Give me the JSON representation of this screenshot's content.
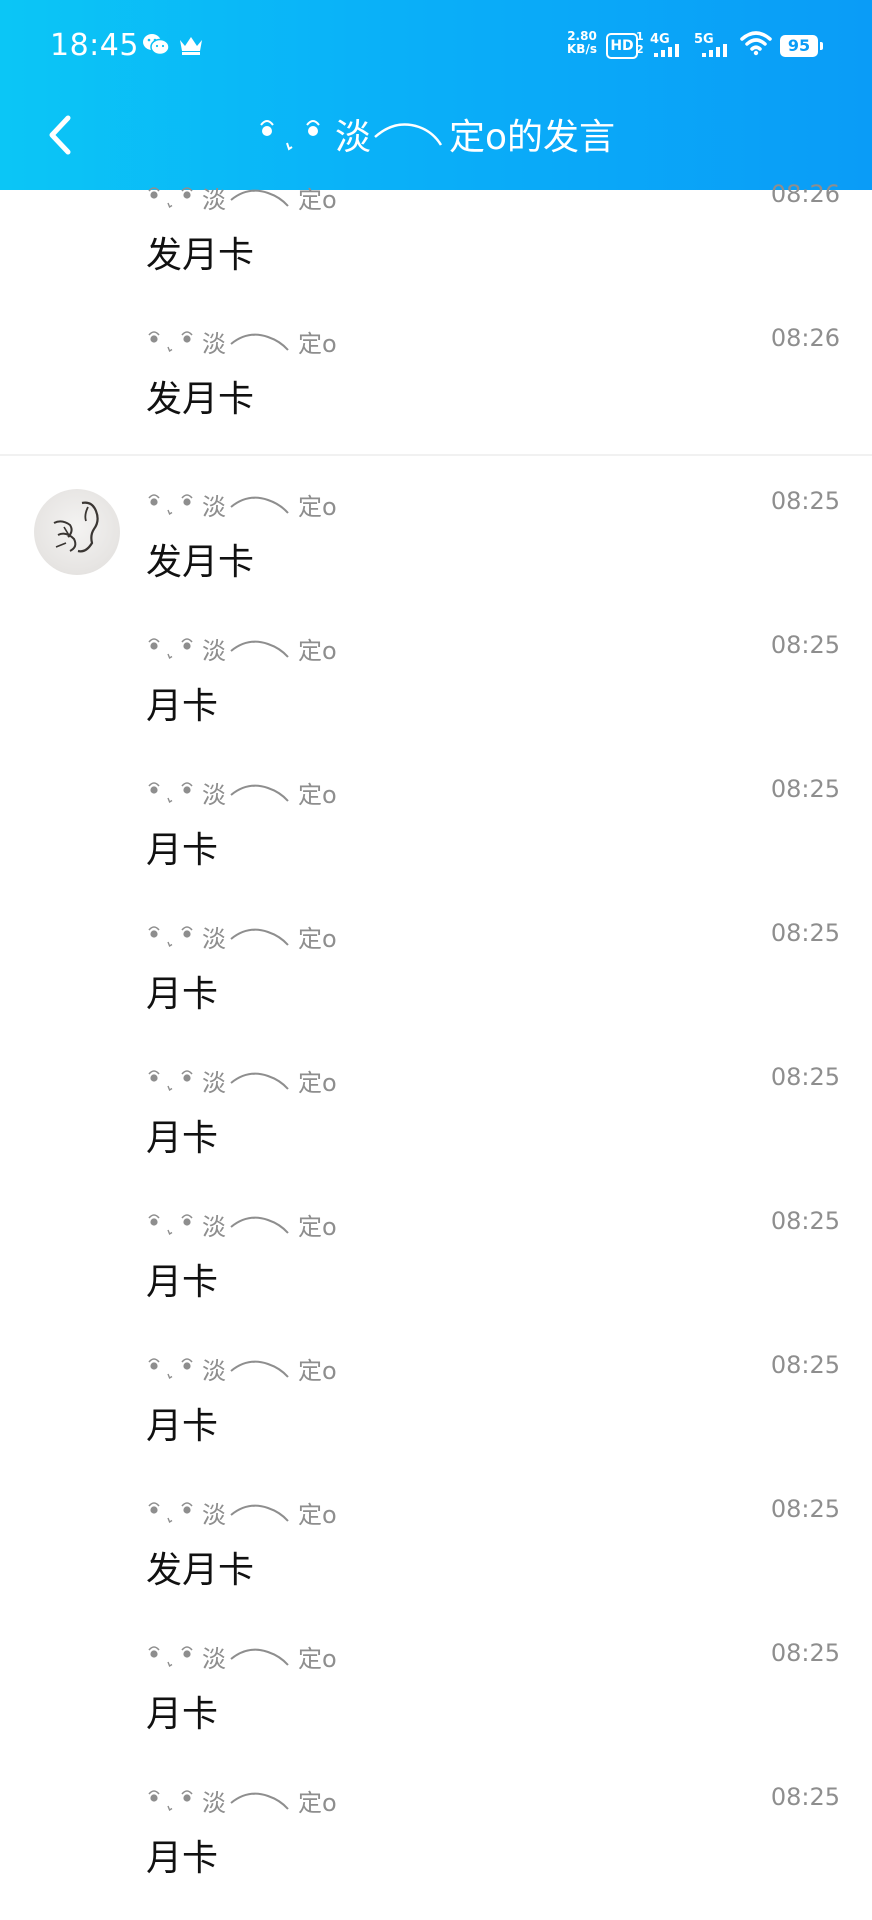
{
  "status_bar": {
    "time": "18:45",
    "network_speed_value": "2.80",
    "network_speed_unit": "KB/s",
    "hd_label": "HD",
    "hd_sub": [
      "1",
      "2"
    ],
    "signal_1_label": "4G",
    "signal_2_label": "5G",
    "battery": "95",
    "icons": [
      "wechat-icon",
      "crown-icon",
      "wifi-icon"
    ]
  },
  "header": {
    "title_text_1": "淡",
    "title_text_2": "定o的发言",
    "back_icon": "chevron-left-icon"
  },
  "colors": {
    "header_gradient_start": "#0bc6f6",
    "header_gradient_end": "#0a9cf7",
    "meta_text": "#8e8e8e",
    "message_text": "#111111"
  },
  "messages": [
    {
      "nick_1": "淡",
      "nick_2": "定o",
      "time": "08:26",
      "text": "发月卡"
    },
    {
      "nick_1": "淡",
      "nick_2": "定o",
      "time": "08:26",
      "text": "发月卡"
    },
    {
      "nick_1": "淡",
      "nick_2": "定o",
      "time": "08:25",
      "text": "发月卡",
      "avatar": true
    },
    {
      "nick_1": "淡",
      "nick_2": "定o",
      "time": "08:25",
      "text": "月卡"
    },
    {
      "nick_1": "淡",
      "nick_2": "定o",
      "time": "08:25",
      "text": "月卡"
    },
    {
      "nick_1": "淡",
      "nick_2": "定o",
      "time": "08:25",
      "text": "月卡"
    },
    {
      "nick_1": "淡",
      "nick_2": "定o",
      "time": "08:25",
      "text": "月卡"
    },
    {
      "nick_1": "淡",
      "nick_2": "定o",
      "time": "08:25",
      "text": "月卡"
    },
    {
      "nick_1": "淡",
      "nick_2": "定o",
      "time": "08:25",
      "text": "月卡"
    },
    {
      "nick_1": "淡",
      "nick_2": "定o",
      "time": "08:25",
      "text": "发月卡"
    },
    {
      "nick_1": "淡",
      "nick_2": "定o",
      "time": "08:25",
      "text": "月卡"
    },
    {
      "nick_1": "淡",
      "nick_2": "定o",
      "time": "08:25",
      "text": "月卡"
    }
  ]
}
